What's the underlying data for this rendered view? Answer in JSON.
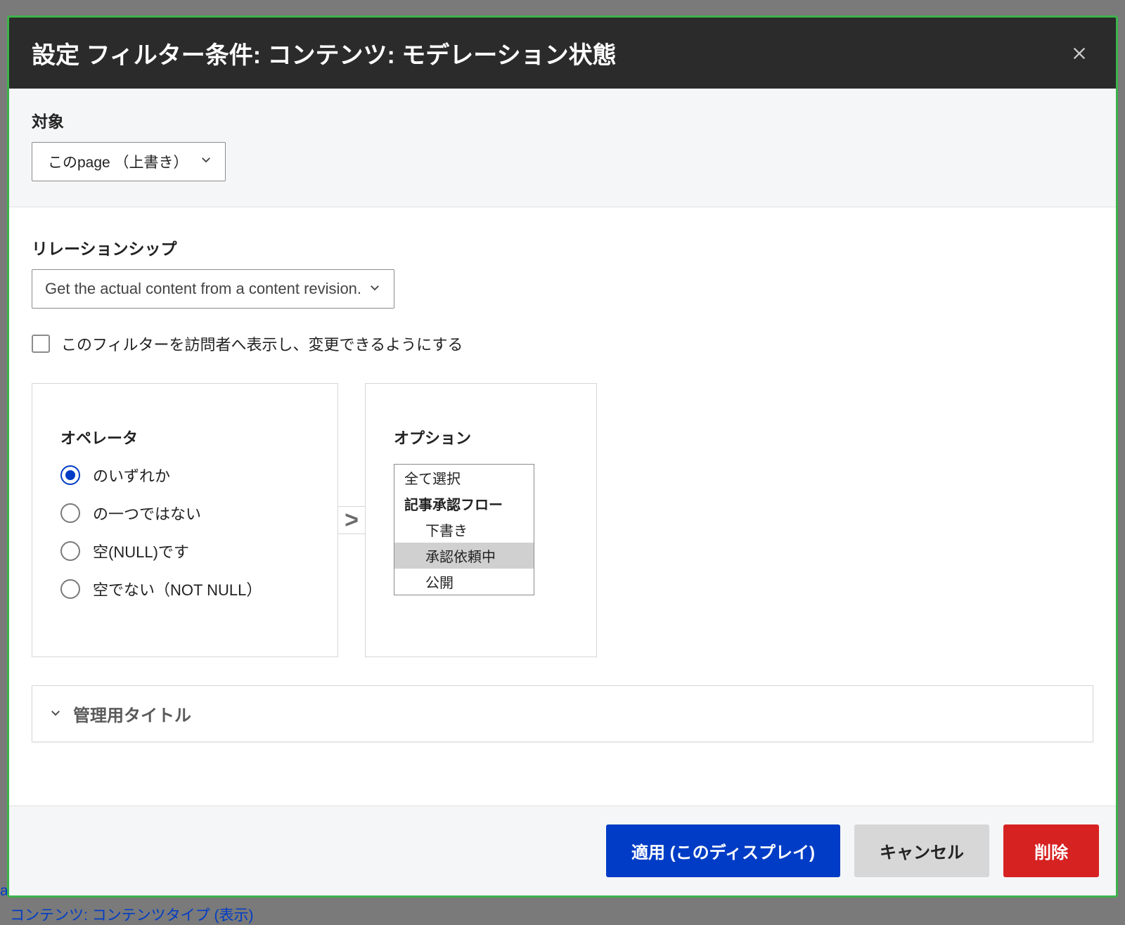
{
  "background": {
    "link1": "actual content from a content",
    "link2": "コンテンツ: コンテンツタイプ (表示)"
  },
  "modal": {
    "title": "設定 フィルター条件: コンテンツ: モデレーション状態",
    "close_label": "close"
  },
  "for_section": {
    "label": "対象",
    "value": "このpage （上書き）"
  },
  "relationship": {
    "label": "リレーションシップ",
    "value": "Get the actual content from a content revision."
  },
  "expose_checkbox": {
    "checked": false,
    "label": "このフィルターを訪問者へ表示し、変更できるようにする"
  },
  "operator": {
    "label": "オペレータ",
    "options": [
      {
        "label": "のいずれか",
        "checked": true
      },
      {
        "label": "の一つではない",
        "checked": false
      },
      {
        "label": "空(NULL)です",
        "checked": false
      },
      {
        "label": "空でない（NOT NULL）",
        "checked": false
      }
    ]
  },
  "collapse_glyph": ">",
  "options": {
    "label": "オプション",
    "select_all": "全て選択",
    "group": "記事承認フロー",
    "items": [
      {
        "label": "下書き",
        "selected": false
      },
      {
        "label": "承認依頼中",
        "selected": true
      },
      {
        "label": "公開",
        "selected": false
      }
    ]
  },
  "admin_title": {
    "label": "管理用タイトル"
  },
  "footer": {
    "apply": "適用 (このディスプレイ)",
    "cancel": "キャンセル",
    "remove": "削除"
  }
}
